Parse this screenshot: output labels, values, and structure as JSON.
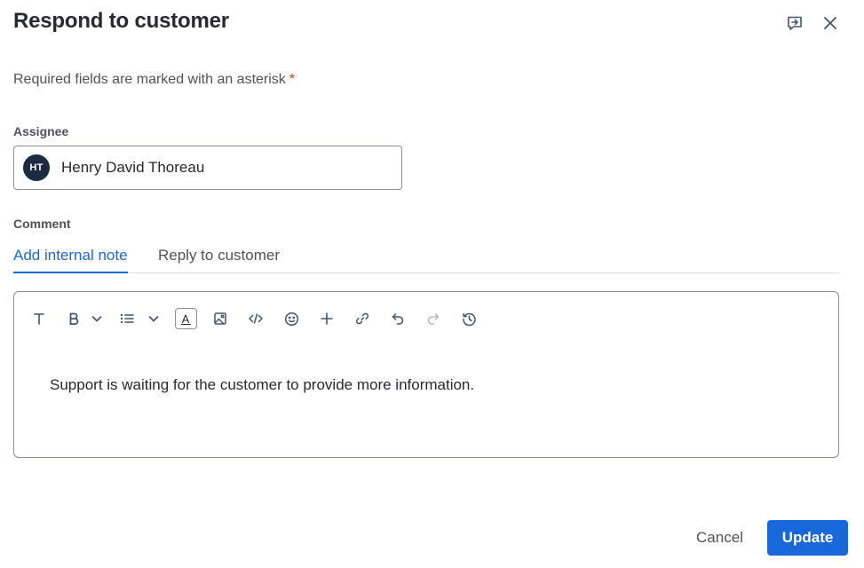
{
  "dialog": {
    "title": "Respond to customer",
    "required_note": "Required fields are marked with an asterisk",
    "required_marker": "*"
  },
  "assignee": {
    "label": "Assignee",
    "initials": "HT",
    "name": "Henry David Thoreau"
  },
  "comment": {
    "label": "Comment",
    "tabs": [
      {
        "label": "Add internal note",
        "active": true
      },
      {
        "label": "Reply to customer",
        "active": false
      }
    ],
    "toolbar_icons": [
      "text-style-icon",
      "bold-icon",
      "chevron-down-icon",
      "bullet-list-icon",
      "chevron-down-icon",
      "text-color-icon",
      "image-icon",
      "code-icon",
      "emoji-icon",
      "plus-icon",
      "link-icon",
      "undo-icon",
      "redo-icon",
      "history-icon"
    ],
    "text_color_glyph": "A",
    "body": "Support is waiting for the customer to provide more information."
  },
  "footer": {
    "cancel_label": "Cancel",
    "update_label": "Update"
  },
  "colors": {
    "accent": "#1868db",
    "required": "#c9372c",
    "avatar": "#1c2b41",
    "text": "#292a2e",
    "subtle_text": "#505258"
  }
}
